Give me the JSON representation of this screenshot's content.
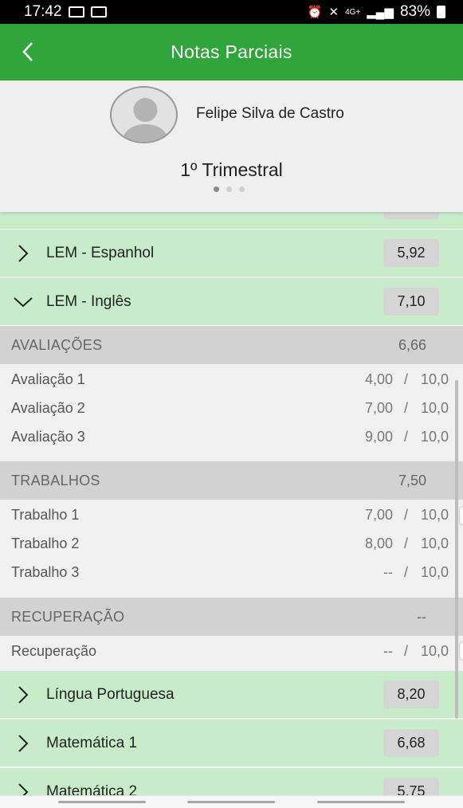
{
  "status_bar": {
    "time": "17:42",
    "network": "4G+",
    "battery": "83%"
  },
  "app_bar": {
    "title": "Notas Parciais"
  },
  "profile": {
    "name": "Felipe Silva de Castro",
    "period": "1º Trimestral"
  },
  "subjects_top": [
    {
      "name": "LEM - Espanhol",
      "grade": "5,92",
      "expanded": false
    },
    {
      "name": "LEM - Inglês",
      "grade": "7,10",
      "expanded": true
    }
  ],
  "sections": [
    {
      "title": "AVALIAÇÕES",
      "value": "6,66",
      "items": [
        {
          "label": "Avaliação 1",
          "score": "4,00",
          "max": "10,0"
        },
        {
          "label": "Avaliação 2",
          "score": "7,00",
          "max": "10,0"
        },
        {
          "label": "Avaliação 3",
          "score": "9,00",
          "max": "10,0"
        }
      ]
    },
    {
      "title": "TRABALHOS",
      "value": "7,50",
      "items": [
        {
          "label": "Trabalho 1",
          "score": "7,00",
          "max": "10,0"
        },
        {
          "label": "Trabalho 2",
          "score": "8,00",
          "max": "10,0"
        },
        {
          "label": "Trabalho 3",
          "score": "--",
          "max": "10,0"
        }
      ]
    },
    {
      "title": "RECUPERAÇÃO",
      "value": "--",
      "items": [
        {
          "label": "Recuperação",
          "score": "--",
          "max": "10,0"
        }
      ]
    }
  ],
  "subjects_bottom": [
    {
      "name": "Língua Portuguesa",
      "grade": "8,20"
    },
    {
      "name": "Matemática 1",
      "grade": "6,68"
    },
    {
      "name": "Matemática 2",
      "grade": "5,75"
    }
  ],
  "slash": "/",
  "colors": {
    "app_bar": "#2fa53c",
    "subject_row": "#c8ecc9",
    "section_header": "#d2d2d2",
    "grade_pill": "#d5d5d5"
  }
}
